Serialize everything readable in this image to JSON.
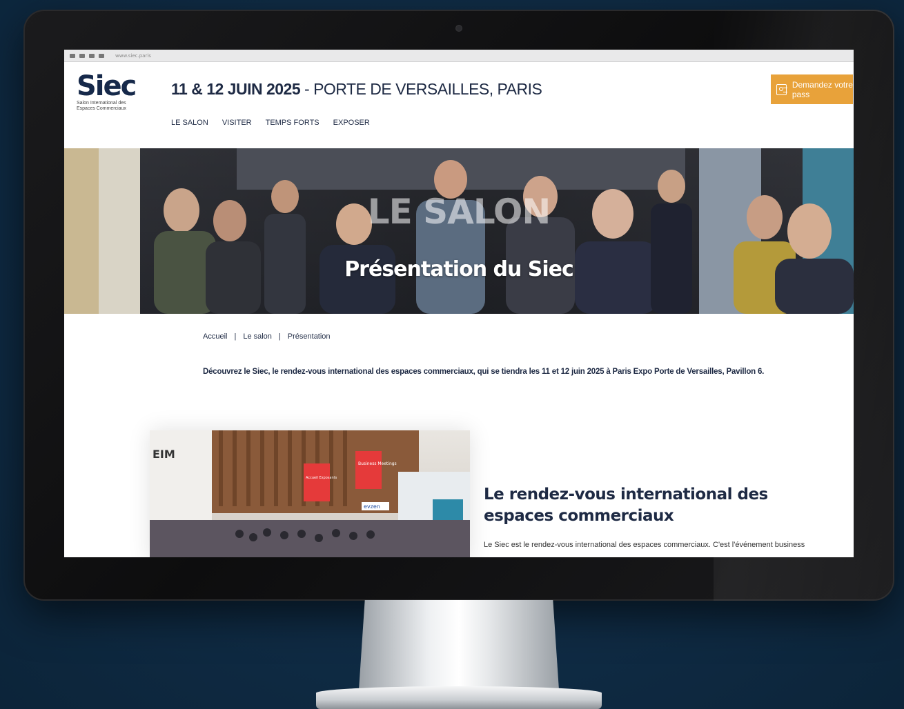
{
  "browser": {
    "url": "www.siec.paris",
    "right": [
      "",
      "",
      ""
    ]
  },
  "header": {
    "logo_word": "Siec",
    "logo_sub": "Salon International des Espaces Commerciaux",
    "title_date": "11 & 12 JUIN 2025",
    "title_rest": " - PORTE DE VERSAILLES, PARIS",
    "nav": [
      "LE SALON",
      "VISITER",
      "TEMPS FORTS",
      "EXPOSER"
    ],
    "pass_button": "Demandez votre pass"
  },
  "hero": {
    "overline": "LE SALON",
    "title": "Présentation du Siec"
  },
  "breadcrumb": {
    "items": [
      "Accueil",
      "Le salon",
      "Présentation"
    ]
  },
  "intro": "Découvrez le Siec, le rendez-vous international des espaces commerciaux, qui se tiendra les 11 et 12 juin 2025 à Paris Expo Porte de Versailles, Pavillon 6.",
  "feature": {
    "heading": "Le rendez-vous international des espaces commerciaux",
    "paragraph": "Le Siec est le rendez-vous international des espaces commerciaux. C'est l'événement business",
    "image_labels": [
      "EIM",
      "Business Meetings",
      "Accueil Exposants",
      "evzen"
    ]
  },
  "colors": {
    "accent": "#e8a23a",
    "brand": "#16294a",
    "background": "#0f2b44"
  }
}
